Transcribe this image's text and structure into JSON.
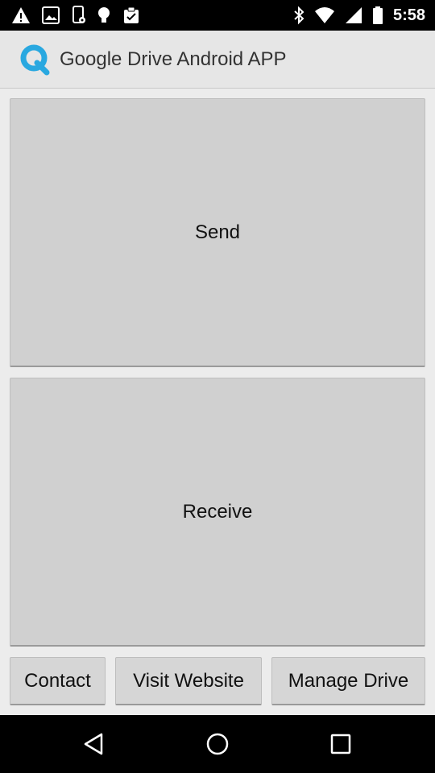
{
  "status_bar": {
    "time": "5:58",
    "left_icons": [
      "warning-icon",
      "image-icon",
      "phone-settings-icon",
      "bulb-icon",
      "clipboard-check-icon"
    ],
    "right_icons": [
      "bluetooth-icon",
      "wifi-icon",
      "signal-icon",
      "battery-icon"
    ]
  },
  "app_bar": {
    "logo_icon": "q-logo-icon",
    "logo_color": "#29a8e0",
    "title": "Google Drive Android APP"
  },
  "main": {
    "send_label": "Send",
    "receive_label": "Receive"
  },
  "bottom_buttons": {
    "contact_label": "Contact",
    "website_label": "Visit Website",
    "manage_label": "Manage Drive"
  },
  "nav_bar": {
    "icons": [
      "back-icon",
      "home-icon",
      "recents-icon"
    ]
  }
}
